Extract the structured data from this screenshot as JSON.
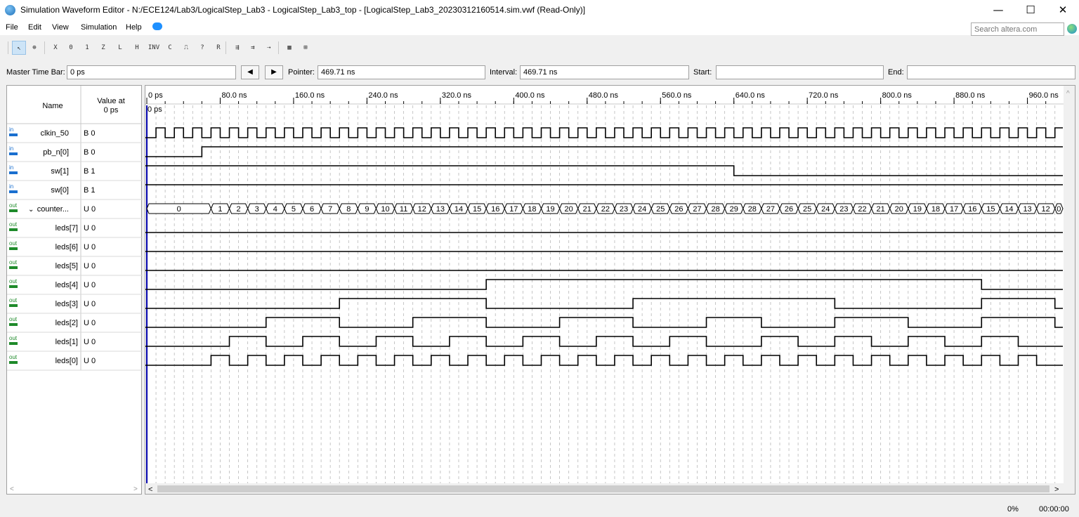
{
  "window": {
    "title": "Simulation Waveform Editor - N:/ECE124/Lab3/LogicalStep_Lab3 - LogicalStep_Lab3_top - [LogicalStep_Lab3_20230312160514.sim.vwf (Read-Only)]",
    "minimize": "—",
    "maximize": "☐",
    "close": "✕"
  },
  "menu": {
    "items": [
      "File",
      "Edit",
      "View",
      "Simulation",
      "Help"
    ]
  },
  "search": {
    "placeholder": "Search altera.com"
  },
  "toolbar": {
    "tools": [
      {
        "name": "select-tool-icon",
        "glyph": "↖"
      },
      {
        "name": "zoom-tool-icon",
        "glyph": "⊕"
      },
      {
        "name": "unknown-value-icon",
        "glyph": "X"
      },
      {
        "name": "force-low-icon",
        "glyph": "0"
      },
      {
        "name": "force-high-icon",
        "glyph": "1"
      },
      {
        "name": "high-impedance-icon",
        "glyph": "Z"
      },
      {
        "name": "weak-low-icon",
        "glyph": "L"
      },
      {
        "name": "weak-high-icon",
        "glyph": "H"
      },
      {
        "name": "invert-icon",
        "glyph": "INV"
      },
      {
        "name": "count-value-icon",
        "glyph": "C"
      },
      {
        "name": "clock-value-icon",
        "glyph": "⎍"
      },
      {
        "name": "arbitrary-value-icon",
        "glyph": "?"
      },
      {
        "name": "random-value-icon",
        "glyph": "R"
      },
      {
        "name": "snap-to-grid-icon",
        "glyph": "⇶"
      },
      {
        "name": "grid-settings-icon",
        "glyph": "⇉"
      },
      {
        "name": "sort-icon",
        "glyph": "⇢"
      },
      {
        "name": "run-functional-sim-icon",
        "glyph": "▦"
      },
      {
        "name": "run-timing-sim-icon",
        "glyph": "⊞"
      }
    ]
  },
  "timebar": {
    "master_label": "Master Time Bar:",
    "master_value": "0 ps",
    "prev": "◀",
    "next": "▶",
    "pointer_label": "Pointer:",
    "pointer_value": "469.71 ns",
    "interval_label": "Interval:",
    "interval_value": "469.71 ns",
    "start_label": "Start:",
    "start_value": "",
    "end_label": "End:",
    "end_value": ""
  },
  "columns": {
    "name": "Name",
    "value_line1": "Value at",
    "value_line2": "0 ps"
  },
  "signals": [
    {
      "dir": "in",
      "name": "clkin_50",
      "value": "B 0",
      "indent": 0
    },
    {
      "dir": "in",
      "name": "pb_n[0]",
      "value": "B 0",
      "indent": 0
    },
    {
      "dir": "in",
      "name": "sw[1]",
      "value": "B 1",
      "indent": 0
    },
    {
      "dir": "in",
      "name": "sw[0]",
      "value": "B 1",
      "indent": 0
    },
    {
      "dir": "out",
      "name": "counter...",
      "value": "U 0",
      "indent": 0,
      "expanded": true
    },
    {
      "dir": "out",
      "name": "leds[7]",
      "value": "U 0",
      "indent": 1
    },
    {
      "dir": "out",
      "name": "leds[6]",
      "value": "U 0",
      "indent": 1
    },
    {
      "dir": "out",
      "name": "leds[5]",
      "value": "U 0",
      "indent": 1
    },
    {
      "dir": "out",
      "name": "leds[4]",
      "value": "U 0",
      "indent": 1
    },
    {
      "dir": "out",
      "name": "leds[3]",
      "value": "U 0",
      "indent": 1
    },
    {
      "dir": "out",
      "name": "leds[2]",
      "value": "U 0",
      "indent": 1
    },
    {
      "dir": "out",
      "name": "leds[1]",
      "value": "U 0",
      "indent": 1
    },
    {
      "dir": "out",
      "name": "leds[0]",
      "value": "U 0",
      "indent": 1
    }
  ],
  "waveform": {
    "time_unit": "ns",
    "time_range_ns": [
      0,
      1000
    ],
    "time_ticks": [
      "0 ps",
      "80.0 ns",
      "160.0 ns",
      "240.0 ns",
      "320.0 ns",
      "400.0 ns",
      "480.0 ns",
      "560.0 ns",
      "640.0 ns",
      "720.0 ns",
      "800.0 ns",
      "880.0 ns",
      "960.0 ns"
    ],
    "cursor_label": "0 ps",
    "clock_period_ns": 20,
    "pb_n_rise_ns": 60,
    "sw1_fall_ns": 640,
    "counter_first_change_ns": 70,
    "counter_step_ns": 20,
    "counter_initial": "0",
    "counter_values": [
      "1",
      "2",
      "3",
      "4",
      "5",
      "6",
      "7",
      "8",
      "9",
      "10",
      "11",
      "12",
      "13",
      "14",
      "15",
      "16",
      "17",
      "18",
      "19",
      "20",
      "21",
      "22",
      "23",
      "24",
      "25",
      "26",
      "27",
      "28",
      "29",
      "28",
      "27",
      "26",
      "25",
      "24",
      "23",
      "22",
      "21",
      "20",
      "19",
      "18",
      "17",
      "16",
      "15",
      "14",
      "13",
      "12",
      "0"
    ]
  },
  "status": {
    "percent": "0%",
    "elapsed": "00:00:00"
  },
  "colors": {
    "wave": "#000000",
    "grid": "#b8b8b8",
    "cursor": "#0000aa",
    "in_icon": "#1a6fcf",
    "out_icon": "#1e8a2a"
  }
}
